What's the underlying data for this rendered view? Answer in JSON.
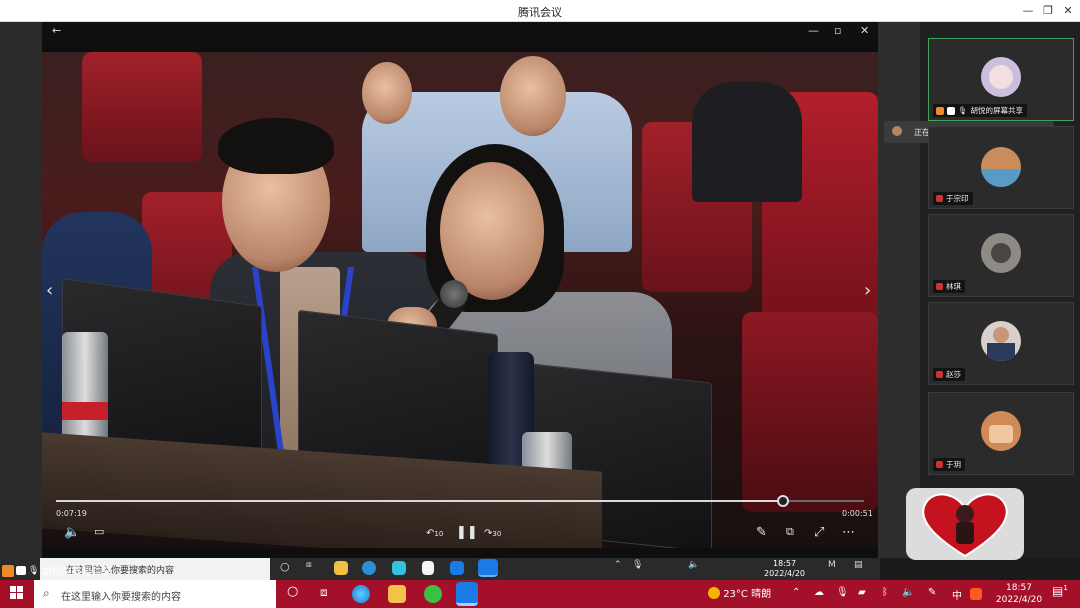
{
  "window": {
    "title": "腾讯会议"
  },
  "viewer": {
    "time_current": "0:07:19",
    "time_total": "0:00:51",
    "progress": 0.9,
    "skip_back_label": "10",
    "skip_fwd_label": "30"
  },
  "speaking": {
    "text": "正在讲话: 胡悦;"
  },
  "participants": [
    {
      "name": "胡悦的屏幕共享",
      "active": true,
      "avatar_color": "#cbbfe0"
    },
    {
      "name": "于宗印",
      "active": false,
      "avatar_color": "#c98c5a"
    },
    {
      "name": "林琪",
      "active": false,
      "avatar_color": "#8e8a86"
    },
    {
      "name": "赵莎",
      "active": false,
      "avatar_color": "#d7d0cc"
    },
    {
      "name": "于玥",
      "active": false,
      "avatar_color": "#d08a58"
    }
  ],
  "share": {
    "label": "胡悦的屏幕共享"
  },
  "inner_taskbar": {
    "search_placeholder": "在这里输入你要搜索的内容",
    "time": "18:57",
    "date": "2022/4/20"
  },
  "taskbar": {
    "search_placeholder": "在这里输入你要搜索的内容",
    "weather": "23°C 晴朗",
    "ime": "中",
    "time": "18:57",
    "date": "2022/4/20",
    "notif_count": "1"
  },
  "colors": {
    "accent_green": "#3fa35a",
    "taskbar_red": "#a4102a"
  }
}
